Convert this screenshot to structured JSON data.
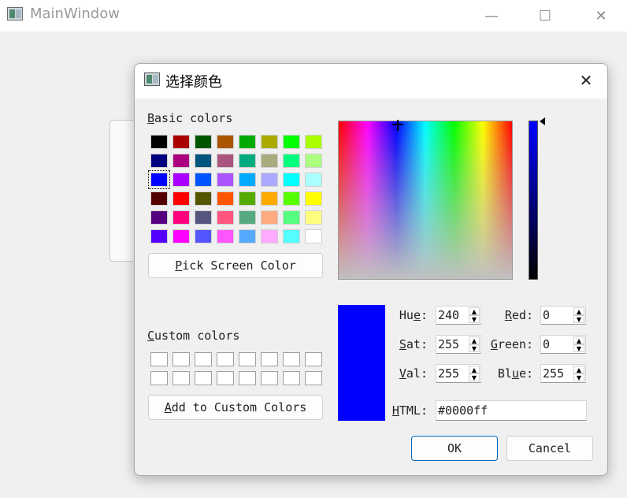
{
  "main_window": {
    "title": "MainWindow",
    "controls": {
      "minimize": "—",
      "maximize": "☐",
      "close": "✕"
    }
  },
  "dialog": {
    "title": "选择颜色",
    "close_glyph": "✕",
    "basic_colors_label": {
      "accel": "B",
      "rest": "asic colors"
    },
    "basic_colors": [
      "#000000",
      "#aa0000",
      "#005500",
      "#aa5500",
      "#00aa00",
      "#aaaa00",
      "#00ff00",
      "#aaff00",
      "#00007f",
      "#aa007f",
      "#00557f",
      "#aa557f",
      "#00aa7f",
      "#aaaa7f",
      "#00ff7f",
      "#aaff7f",
      "#0000ff",
      "#aa00ff",
      "#0055ff",
      "#aa55ff",
      "#00aaff",
      "#aaaaff",
      "#00ffff",
      "#aaffff",
      "#550000",
      "#ff0000",
      "#555500",
      "#ff5500",
      "#55aa00",
      "#ffaa00",
      "#55ff00",
      "#ffff00",
      "#55007f",
      "#ff007f",
      "#55557f",
      "#ff557f",
      "#55aa7f",
      "#ffaa7f",
      "#55ff7f",
      "#ffff7f",
      "#5500ff",
      "#ff00ff",
      "#5555ff",
      "#ff55ff",
      "#55aaff",
      "#ffaaff",
      "#55ffff",
      "#ffffff"
    ],
    "selected_basic_index": 16,
    "pick_screen_color": {
      "accel": "P",
      "rest": "ick Screen Color"
    },
    "custom_colors_label": {
      "accel": "C",
      "rest": "ustom colors"
    },
    "custom_color_count": 16,
    "add_custom": {
      "pre": "",
      "accel": "A",
      "rest": "dd to Custom Colors"
    },
    "current_color": "#0000ff",
    "fields": {
      "hue": {
        "pre": "Hu",
        "accel": "e",
        "post": ":",
        "value": "240"
      },
      "sat": {
        "pre": "",
        "accel": "S",
        "post": "at:",
        "value": "255"
      },
      "val": {
        "pre": "",
        "accel": "V",
        "post": "al:",
        "value": "255"
      },
      "red": {
        "pre": "",
        "accel": "R",
        "post": "ed:",
        "value": "0"
      },
      "green": {
        "pre": "",
        "accel": "G",
        "post": "reen:",
        "value": "0"
      },
      "blue": {
        "pre": "Bl",
        "accel": "u",
        "post": "e:",
        "value": "255"
      }
    },
    "html": {
      "pre": "",
      "accel": "H",
      "post": "TML:",
      "value": "#0000ff"
    },
    "ok_label": "OK",
    "cancel_label": "Cancel"
  }
}
